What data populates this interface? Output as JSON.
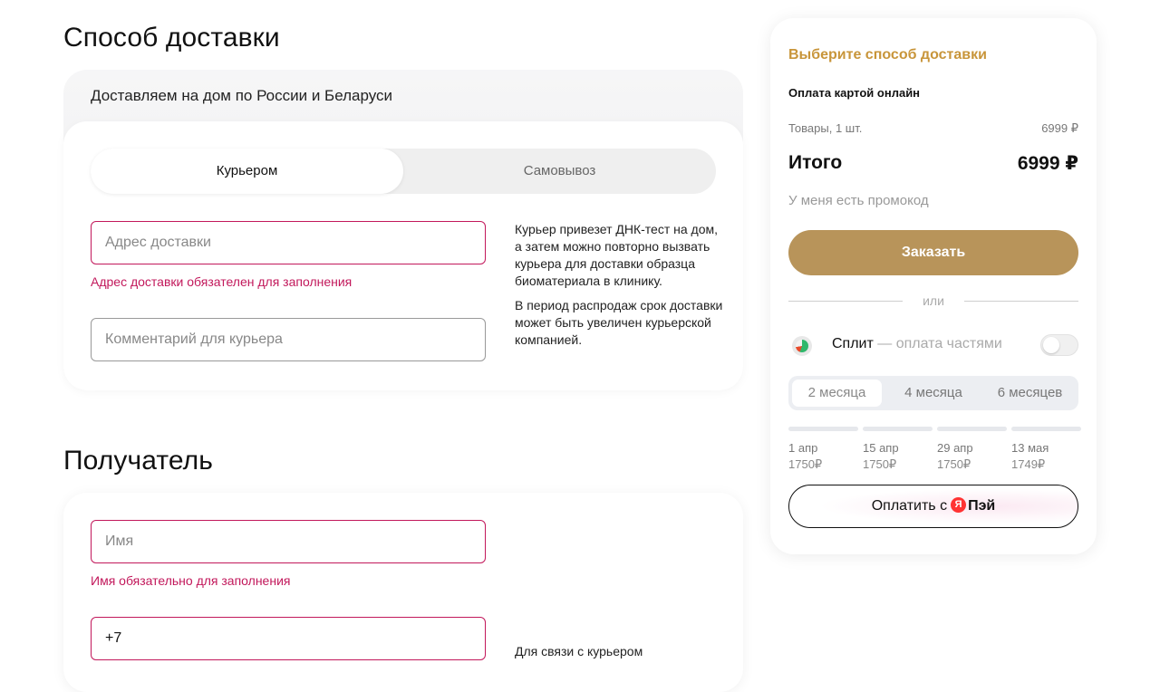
{
  "delivery": {
    "heading": "Способ доставки",
    "subtitle": "Доставляем на дом по России и Беларуси",
    "tabs": {
      "courier": "Курьером",
      "pickup": "Самовывоз"
    },
    "address_placeholder": "Адрес доставки",
    "address_error": "Адрес доставки обязателен для заполнения",
    "comment_placeholder": "Комментарий для курьера",
    "note_1": "Курьер привезет ДНК-тест на дом, а затем можно повторно вызвать курьера для доставки образца биоматериала в клинику.",
    "note_2": "В период распродаж срок доставки может быть увеличен курьерской компанией."
  },
  "recipient": {
    "heading": "Получатель",
    "name_placeholder": "Имя",
    "name_error": "Имя обязательно для заполнения",
    "phone_value": "+7",
    "phone_note": "Для связи с курьером"
  },
  "summary": {
    "title": "Выберите способ доставки",
    "payment_method": "Оплата картой онлайн",
    "goods_label": "Товары, 1 шт.",
    "goods_price": "6999 ₽",
    "total_label": "Итого",
    "total_price": "6999 ₽",
    "promo_link": "У меня есть промокод",
    "order_button": "Заказать",
    "or_text": "или",
    "split": {
      "name": "Сплит",
      "sub": "— оплата частями",
      "enabled": false,
      "months": [
        "2 месяца",
        "4 месяца",
        "6 месяцев"
      ],
      "selected_month": "2 месяца",
      "schedule": [
        {
          "date": "1 апр",
          "amount": "1750₽"
        },
        {
          "date": "15 апр",
          "amount": "1750₽"
        },
        {
          "date": "29 апр",
          "amount": "1750₽"
        },
        {
          "date": "13 мая",
          "amount": "1749₽"
        }
      ]
    },
    "yapay": {
      "prefix": "Оплатить с",
      "logo_letter": "Я",
      "word": "Пэй"
    }
  },
  "colors": {
    "accent_gold": "#b8945a",
    "title_gold": "#c8953a",
    "error": "#c2185b"
  }
}
